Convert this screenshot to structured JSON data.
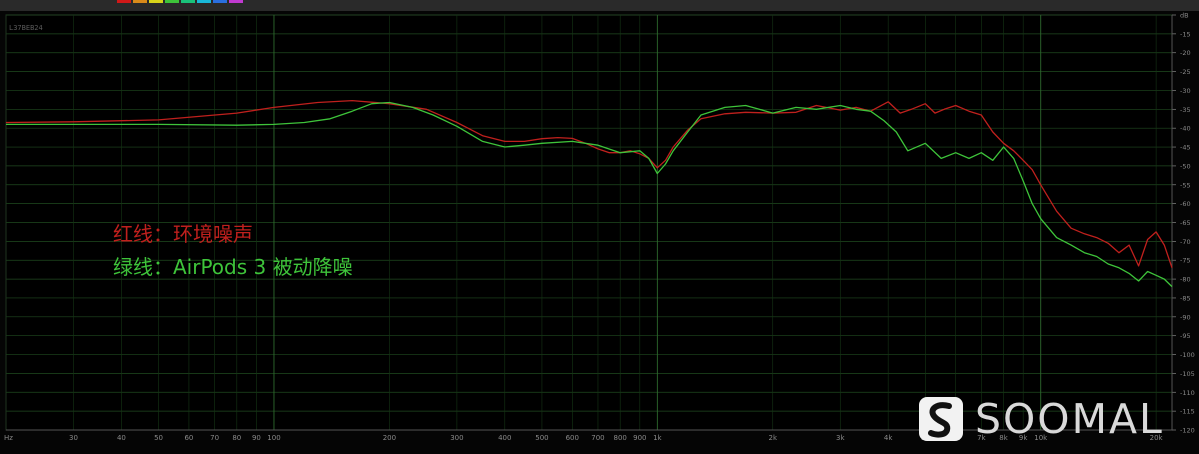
{
  "toolbar": {
    "swatch_colors": [
      "#d01818",
      "#d88a1a",
      "#d8d31a",
      "#3ec43a",
      "#1ac27a",
      "#19b8d9",
      "#2a6fe0",
      "#c03ad0"
    ]
  },
  "corner_label": "L37BEB24",
  "legend": {
    "red": "红线：环境噪声",
    "green": "绿线：AirPods 3 被动降噪"
  },
  "watermark": {
    "text": "SOOMAL",
    "logo_icon": "soomal-s-logo-icon"
  },
  "chart_data": {
    "type": "line",
    "x_scale": "log",
    "xlim": [
      20,
      22000
    ],
    "ylim": [
      -120,
      -10
    ],
    "grid": true,
    "x_ticks": [
      {
        "v": 20,
        "label": "Hz"
      },
      {
        "v": 30,
        "label": "30"
      },
      {
        "v": 40,
        "label": "40"
      },
      {
        "v": 50,
        "label": "50"
      },
      {
        "v": 60,
        "label": "60"
      },
      {
        "v": 70,
        "label": "70"
      },
      {
        "v": 80,
        "label": "80"
      },
      {
        "v": 90,
        "label": "90"
      },
      {
        "v": 100,
        "label": "100"
      },
      {
        "v": 200,
        "label": "200"
      },
      {
        "v": 300,
        "label": "300"
      },
      {
        "v": 400,
        "label": "400"
      },
      {
        "v": 500,
        "label": "500"
      },
      {
        "v": 600,
        "label": "600"
      },
      {
        "v": 700,
        "label": "700"
      },
      {
        "v": 800,
        "label": "800"
      },
      {
        "v": 900,
        "label": "900"
      },
      {
        "v": 1000,
        "label": "1k"
      },
      {
        "v": 2000,
        "label": "2k"
      },
      {
        "v": 3000,
        "label": "3k"
      },
      {
        "v": 4000,
        "label": "4k"
      },
      {
        "v": 5000,
        "label": "5k"
      },
      {
        "v": 6000,
        "label": "6k"
      },
      {
        "v": 7000,
        "label": "7k"
      },
      {
        "v": 8000,
        "label": "8k"
      },
      {
        "v": 9000,
        "label": "9k"
      },
      {
        "v": 10000,
        "label": "10k"
      },
      {
        "v": 20000,
        "label": "20k"
      }
    ],
    "y_ticks": [
      {
        "v": -10,
        "label": "dB"
      },
      {
        "v": -15,
        "label": "-15"
      },
      {
        "v": -20,
        "label": "-20"
      },
      {
        "v": -25,
        "label": "-25"
      },
      {
        "v": -30,
        "label": "-30"
      },
      {
        "v": -35,
        "label": "-35"
      },
      {
        "v": -40,
        "label": "-40"
      },
      {
        "v": -45,
        "label": "-45"
      },
      {
        "v": -50,
        "label": "-50"
      },
      {
        "v": -55,
        "label": "-55"
      },
      {
        "v": -60,
        "label": "-60"
      },
      {
        "v": -65,
        "label": "-65"
      },
      {
        "v": -70,
        "label": "-70"
      },
      {
        "v": -75,
        "label": "-75"
      },
      {
        "v": -80,
        "label": "-80"
      },
      {
        "v": -85,
        "label": "-85"
      },
      {
        "v": -90,
        "label": "-90"
      },
      {
        "v": -95,
        "label": "-95"
      },
      {
        "v": -100,
        "label": "-100"
      },
      {
        "v": -105,
        "label": "-105"
      },
      {
        "v": -110,
        "label": "-110"
      },
      {
        "v": -115,
        "label": "-115"
      },
      {
        "v": -120,
        "label": "-120"
      }
    ],
    "series": [
      {
        "name": "红线：环境噪声",
        "color": "#c0201d",
        "x": [
          20,
          30,
          50,
          80,
          100,
          130,
          160,
          200,
          250,
          300,
          350,
          400,
          450,
          500,
          550,
          600,
          650,
          700,
          750,
          800,
          850,
          900,
          950,
          1000,
          1050,
          1100,
          1200,
          1300,
          1500,
          1700,
          2000,
          2300,
          2600,
          3000,
          3300,
          3600,
          4000,
          4300,
          4600,
          5000,
          5300,
          5600,
          6000,
          6500,
          7000,
          7500,
          8000,
          8500,
          9000,
          9500,
          10000,
          11000,
          12000,
          13000,
          14000,
          15000,
          16000,
          17000,
          18000,
          19000,
          20000,
          21000,
          22000
        ],
        "y": [
          -38.5,
          -38.3,
          -37.8,
          -36.0,
          -34.5,
          -33.2,
          -32.7,
          -33.5,
          -35.0,
          -38.5,
          -42.0,
          -43.5,
          -43.5,
          -42.8,
          -42.5,
          -42.7,
          -44.0,
          -45.5,
          -46.5,
          -46.5,
          -46.0,
          -46.8,
          -48.0,
          -50.5,
          -48.5,
          -45.0,
          -40.5,
          -37.5,
          -36.2,
          -35.8,
          -36.0,
          -35.8,
          -34.0,
          -35.2,
          -34.5,
          -35.5,
          -33.0,
          -36.0,
          -35.0,
          -33.5,
          -36.0,
          -35.0,
          -34.0,
          -35.5,
          -36.5,
          -41.0,
          -44.0,
          -46.0,
          -48.5,
          -51.0,
          -55.0,
          -62.0,
          -66.5,
          -68.0,
          -69.0,
          -70.5,
          -73.0,
          -71.0,
          -76.5,
          -69.5,
          -67.5,
          -71.0,
          -77.0
        ]
      },
      {
        "name": "绿线：AirPods 3 被动降噪",
        "color": "#3ec43a",
        "x": [
          20,
          30,
          50,
          80,
          100,
          120,
          140,
          160,
          180,
          200,
          230,
          260,
          300,
          350,
          400,
          450,
          500,
          600,
          700,
          800,
          900,
          950,
          1000,
          1050,
          1100,
          1200,
          1300,
          1500,
          1700,
          2000,
          2300,
          2600,
          3000,
          3300,
          3600,
          3900,
          4200,
          4500,
          5000,
          5500,
          6000,
          6500,
          7000,
          7500,
          8000,
          8500,
          9000,
          9500,
          10000,
          11000,
          12000,
          13000,
          14000,
          15000,
          16000,
          17000,
          18000,
          19000,
          20000,
          21000,
          22000
        ],
        "y": [
          -39.0,
          -39.0,
          -39.0,
          -39.2,
          -39.0,
          -38.5,
          -37.5,
          -35.5,
          -33.5,
          -33.2,
          -34.5,
          -36.5,
          -39.5,
          -43.5,
          -45.0,
          -44.5,
          -44.0,
          -43.5,
          -44.5,
          -46.5,
          -46.0,
          -48.0,
          -52.0,
          -49.5,
          -46.0,
          -41.0,
          -36.5,
          -34.5,
          -34.0,
          -36.0,
          -34.5,
          -35.0,
          -34.0,
          -35.0,
          -35.5,
          -38.0,
          -41.0,
          -46.0,
          -44.0,
          -48.0,
          -46.5,
          -48.0,
          -46.5,
          -48.5,
          -45.0,
          -48.0,
          -54.0,
          -60.0,
          -64.0,
          -69.0,
          -71.0,
          -73.0,
          -74.0,
          -76.0,
          -77.0,
          -78.5,
          -80.5,
          -78.0,
          -79.0,
          -80.0,
          -82.0
        ]
      }
    ]
  }
}
